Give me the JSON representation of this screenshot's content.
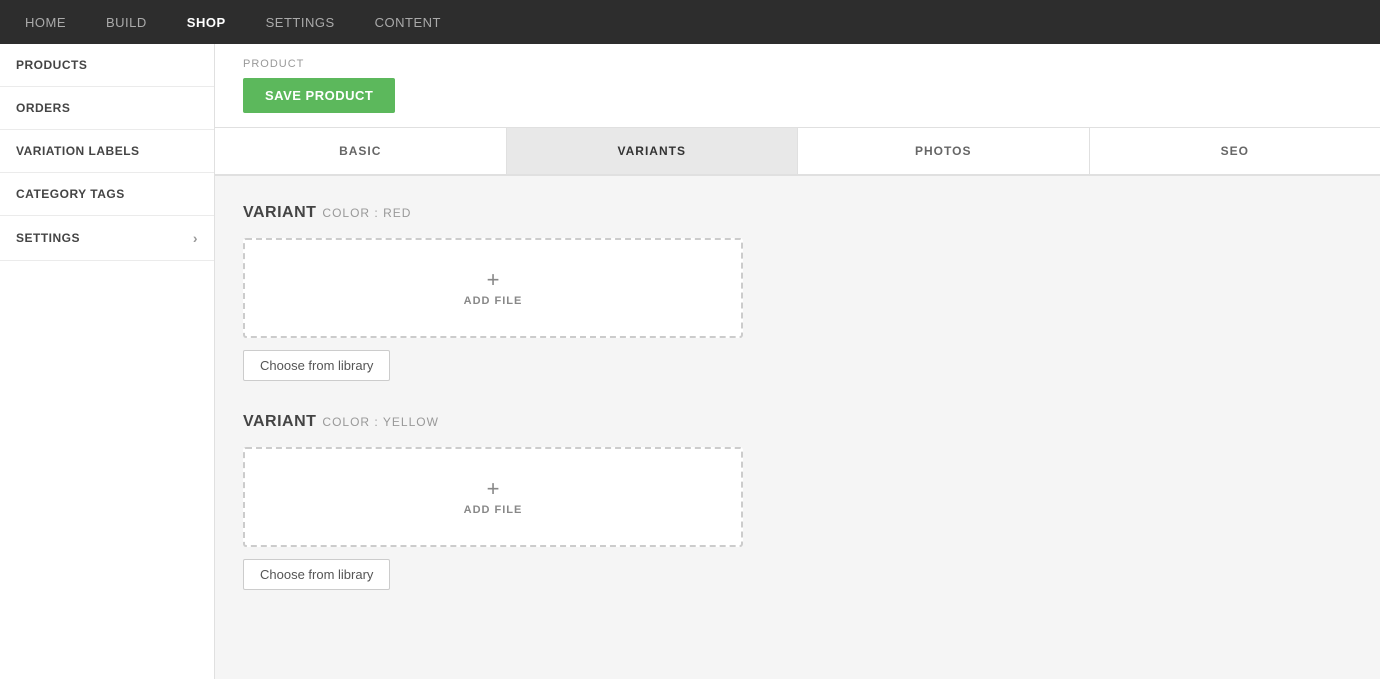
{
  "nav": {
    "items": [
      {
        "label": "HOME",
        "active": false
      },
      {
        "label": "BUILD",
        "active": false
      },
      {
        "label": "SHOP",
        "active": true
      },
      {
        "label": "SETTINGS",
        "active": false
      },
      {
        "label": "CONTENT",
        "active": false
      }
    ]
  },
  "sidebar": {
    "items": [
      {
        "label": "PRODUCTS",
        "hasChevron": false
      },
      {
        "label": "ORDERS",
        "hasChevron": false
      },
      {
        "label": "VARIATION LABELS",
        "hasChevron": false
      },
      {
        "label": "CATEGORY TAGS",
        "hasChevron": false
      },
      {
        "label": "SETTINGS",
        "hasChevron": true
      }
    ]
  },
  "product": {
    "section_label": "PRODUCT",
    "save_button": "SAVE PRODUCT"
  },
  "tabs": [
    {
      "label": "BASIC",
      "active": false
    },
    {
      "label": "VARIANTS",
      "active": true
    },
    {
      "label": "PHOTOS",
      "active": false
    },
    {
      "label": "SEO",
      "active": false
    }
  ],
  "variants": [
    {
      "title": "VARIANT",
      "color_label": "COLOR : RED",
      "add_file_icon": "+",
      "add_file_label": "ADD FILE",
      "choose_library_btn": "Choose from library"
    },
    {
      "title": "VARIANT",
      "color_label": "COLOR : YELLOW",
      "add_file_icon": "+",
      "add_file_label": "ADD FILE",
      "choose_library_btn": "Choose from library"
    }
  ]
}
